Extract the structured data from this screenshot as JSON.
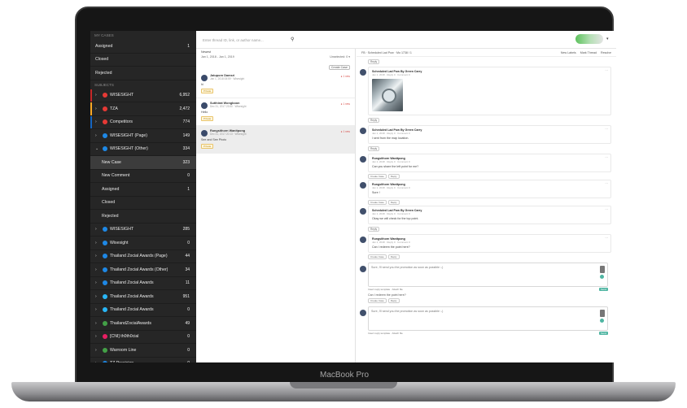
{
  "device": {
    "label": "MacBook Pro"
  },
  "topbar": {
    "search_placeholder": "Enter thread ID, link, or author name...",
    "user_caret": "▾"
  },
  "sidebar": {
    "my_cases_title": "MY CASES",
    "my_cases": [
      {
        "label": "Assigned",
        "count": "1"
      },
      {
        "label": "Closed",
        "count": ""
      },
      {
        "label": "Rejected",
        "count": ""
      }
    ],
    "subjects_title": "SUBJECTS",
    "subjects": [
      {
        "label": "WISESIGHT",
        "count": "6,952",
        "color": "#e53935",
        "bar": "#c62828",
        "kind": "search"
      },
      {
        "label": "TZA",
        "count": "2,472",
        "color": "#e53935",
        "bar": "#f9a825",
        "kind": "search"
      },
      {
        "label": "Competitors",
        "count": "774",
        "color": "#e53935",
        "bar": "#1565c0",
        "kind": "search"
      },
      {
        "label": "WISESIGHT (Page)",
        "count": "149",
        "color": "#1e88e5",
        "bar": "",
        "kind": "facebook"
      },
      {
        "label": "WISESIGHT (Other)",
        "count": "334",
        "color": "#1e88e5",
        "bar": "",
        "kind": "facebook",
        "open": true
      }
    ],
    "sub_items": [
      {
        "label": "New Case",
        "count": "323",
        "active": true
      },
      {
        "label": "New Comment",
        "count": "0"
      },
      {
        "label": "Assigned",
        "count": "1"
      },
      {
        "label": "Closed",
        "count": ""
      },
      {
        "label": "Rejected",
        "count": ""
      }
    ],
    "more_subjects": [
      {
        "label": "WISESIGHT",
        "count": "285",
        "color": "#1e88e5"
      },
      {
        "label": "Wisesight",
        "count": "0",
        "color": "#1e88e5"
      },
      {
        "label": "Thailand Zocial Awards (Page)",
        "count": "44",
        "color": "#1e88e5"
      },
      {
        "label": "Thailand Zocial Awards (Other)",
        "count": "34",
        "color": "#1e88e5"
      },
      {
        "label": "Thailand Zocial Awards",
        "count": "11",
        "color": "#1e88e5"
      },
      {
        "label": "Thailand Zocial Awards",
        "count": "951",
        "color": "#29b6f6"
      },
      {
        "label": "Thailand Zocial Awards",
        "count": "0",
        "color": "#29b6f6"
      },
      {
        "label": "ThailandZocialAwards",
        "count": "49",
        "color": "#43a047"
      },
      {
        "label": "[CNI] th0th0cial",
        "count": "0",
        "color": "#e91e63"
      },
      {
        "label": "Warroom Line",
        "count": "0",
        "color": "#43a047"
      },
      {
        "label": "TZ Precision",
        "count": "0",
        "color": "#1e88e5"
      },
      {
        "label": "TZ Precision (Other)",
        "count": "0",
        "color": "#1e88e5"
      }
    ]
  },
  "list": {
    "header": "Newest",
    "filter_left": "Jan 1, 2018 - Jan 1, 2019",
    "filter_right": "Unselected: 0 ▾",
    "filter_pill": "Create Case",
    "items": [
      {
        "name": "Jatuporn Damsri",
        "meta": "Jan 1, 2018 08:59 · Wisesight",
        "body": "hi",
        "tag": "Private",
        "unread": "● 1 new"
      },
      {
        "name": "Sutthirat Wongboon",
        "meta": "Dec 31, 2017 23:50 · Wisesight",
        "body": "Hello",
        "tag": "Private",
        "unread": "● 1 new"
      },
      {
        "name": "Rungsithorn Wanitpong",
        "meta": "Dec 31, 2017 20:13 · Wisesight",
        "body": "See and See Photo",
        "tag": "Private",
        "unread": "● 1 new",
        "selected": true
      }
    ]
  },
  "thread": {
    "title": "FB · Scheduled Lad Pow · Mo 1738 / 1",
    "actions": [
      "New Labels",
      "Mark Thread",
      "Resolve"
    ],
    "reply_label": "Reply",
    "messages": [
      {
        "name": "Scheduled Lad Pow By Green Carry",
        "meta": "Jan 1, 2018 · Reply 0 · Comment 0",
        "text": "",
        "photo": true
      },
      {
        "name": "Scheduled Lad Pow By Green Carry",
        "meta": "Jan 1, 2018 · Reply 0 · Comment 0",
        "text": "I sent from the map location."
      },
      {
        "name": "Rungsithorn Wanitpong",
        "meta": "Jan 1, 2018 · Reply 0 · Comment 0",
        "text": "Can you share the left point for me?"
      },
      {
        "name": "Rungsithorn Wanitpong",
        "meta": "Jan 1, 2018 · Reply 0 · Comment 0",
        "text": "Sure !"
      },
      {
        "name": "Scheduled Lad Pow By Green Carry",
        "meta": "Jan 1, 2018 · Reply 0 · Comment 0",
        "text": "Okay we will check for the top point."
      },
      {
        "name": "Rungsithorn Wanitpong",
        "meta": "Jan 1, 2018 · Reply 0 · Comment 0",
        "text": "Can I redeem the point here?"
      }
    ],
    "chips": [
      "Create Case",
      "Reply"
    ],
    "composer_1": "Sure, I'll send you the promotion as soon as possible :-)",
    "composer_2": "Sure, I'll send you the promotion as soon as possible :-)",
    "between_text": "Can I redeem the point here?",
    "composer_bar_left": "Insert reply template · Attach file",
    "send_label": "Send"
  }
}
